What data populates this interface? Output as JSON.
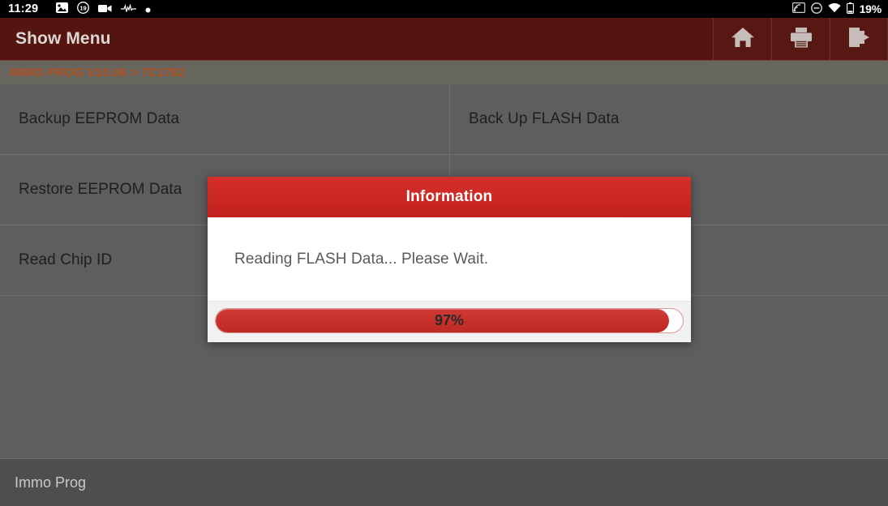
{
  "status_bar": {
    "clock": "11:29",
    "notification_badge_count": "19",
    "icons": [
      "image-icon",
      "notification-count-icon",
      "video-camera-icon",
      "heartbeat-icon",
      "dot-icon"
    ],
    "right_icons": [
      "cast-screen-icon",
      "do-not-disturb-icon",
      "wifi-icon",
      "battery-icon"
    ],
    "battery_percent": "19%"
  },
  "title_bar": {
    "title": "Show Menu",
    "buttons": [
      {
        "name": "home-button",
        "icon": "home-icon"
      },
      {
        "name": "print-button",
        "icon": "printer-icon"
      },
      {
        "name": "exit-button",
        "icon": "exit-icon"
      }
    ]
  },
  "breadcrumb": {
    "text": "IMMO PROG V10.06 > TC1782"
  },
  "menu": {
    "rows": [
      [
        {
          "label": "Backup EEPROM Data"
        },
        {
          "label": "Back Up FLASH Data"
        }
      ],
      [
        {
          "label": "Restore EEPROM Data"
        },
        {
          "label": ""
        }
      ],
      [
        {
          "label": "Read Chip ID"
        },
        {
          "label": ""
        }
      ]
    ]
  },
  "dialog": {
    "title": "Information",
    "message": "Reading FLASH Data... Please Wait.",
    "progress_percent": 97,
    "progress_label": "97%"
  },
  "bottom_bar": {
    "label": "Immo Prog"
  },
  "colors": {
    "title_bar": "#541511",
    "breadcrumb_bar": "#66665f",
    "breadcrumb_text": "#b4511f",
    "menu_background": "#5e5e5e",
    "dialog_header": "#cb2723",
    "progress_fill": "#c8302b",
    "bottom_bar": "#4e4e4e"
  }
}
